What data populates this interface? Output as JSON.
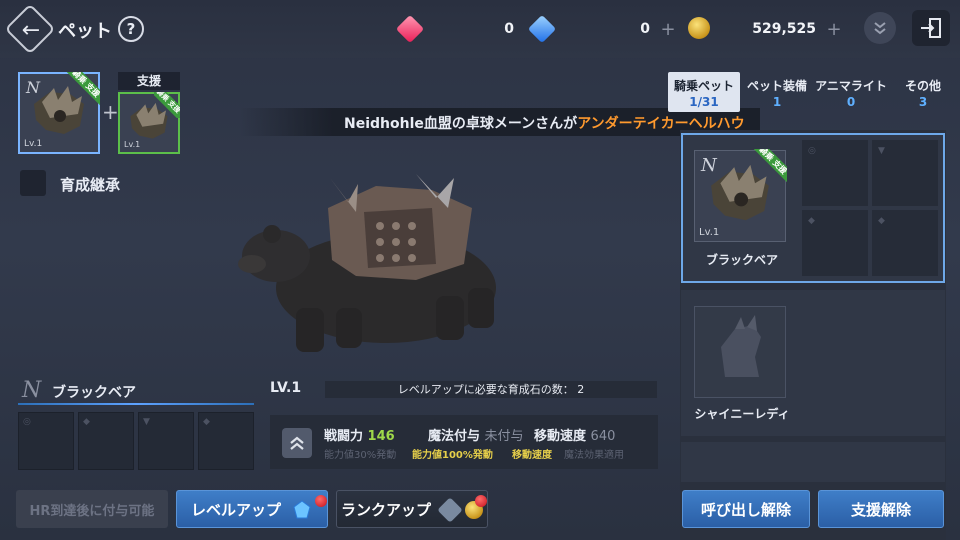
{
  "header": {
    "title": "ペット",
    "help_label": "?",
    "currencies": [
      {
        "name": "red-gem",
        "value": "0",
        "color": "#ff4d7a"
      },
      {
        "name": "blue-gem",
        "value": "0",
        "color": "#4aa8ff"
      },
      {
        "name": "gold-coin",
        "value": "529,525",
        "color": "#e8b53a"
      }
    ]
  },
  "formation": {
    "support_label": "支援",
    "main_pet": {
      "level": "Lv.1",
      "badge": "騎乗 支援"
    },
    "support_pet": {
      "level": "Lv.1",
      "badge": "騎乗 支援"
    },
    "inherit_label": "育成継承"
  },
  "notice": {
    "prefix": "Neidhohle血盟の卓球メーンさんが",
    "highlight": "アンダーテイカーヘルハウンド"
  },
  "selected_pet": {
    "grade_mark": "N",
    "name": "ブラックベア",
    "level_label": "LV.1",
    "level_requirement": "レベルアップに必要な育成石の数： 2"
  },
  "stats": {
    "combat_label": "戦闘力",
    "combat_value": "146",
    "magic_label": "魔法付与",
    "magic_value": "未付与",
    "speed_label": "移動速度",
    "speed_value": "640",
    "sub_1": "能力値30%発動",
    "sub_2": "能力値100%発動",
    "sub_3": "移動速度",
    "sub_4": "魔法効果適用"
  },
  "tabs": [
    {
      "label": "騎乗ペット",
      "count": "1/31"
    },
    {
      "label": "ペット装備",
      "count": "1"
    },
    {
      "label": "アニマライト",
      "count": "0"
    },
    {
      "label": "その他",
      "count": "3"
    }
  ],
  "pet_list": [
    {
      "name": "ブラックベア",
      "level": "Lv.1",
      "grade": "N",
      "badge": "騎乗 支援"
    },
    {
      "name": "シャイニーレディ"
    }
  ],
  "buttons": {
    "disabled": "HR到達後に付与可能",
    "level_up": "レベルアップ",
    "rank_up": "ランクアップ",
    "release_summon": "呼び出し解除",
    "release_support": "支援解除"
  }
}
